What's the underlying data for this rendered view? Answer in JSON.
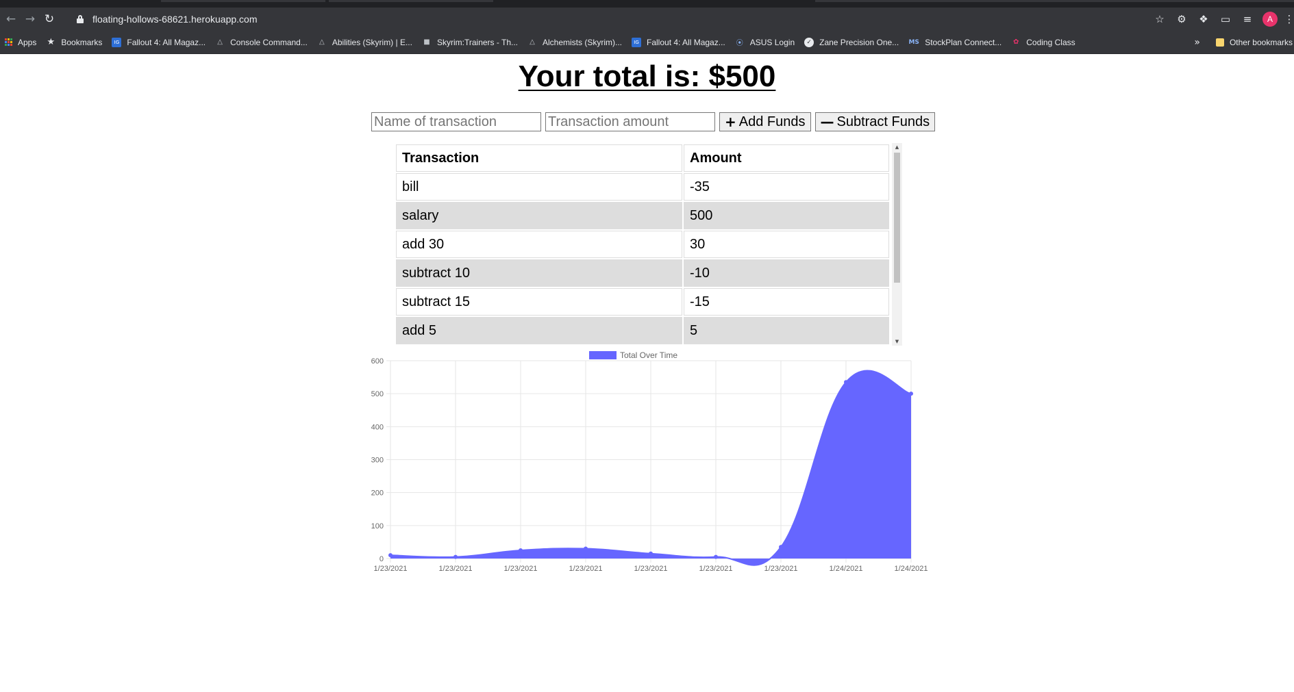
{
  "browser": {
    "url": "floating-hollows-68621.herokuapp.com",
    "avatar_letter": "A",
    "bookmarks": [
      {
        "label": "Apps",
        "icon": "apps-grid-icon"
      },
      {
        "label": "Bookmarks",
        "icon": "star-icon"
      },
      {
        "label": "Fallout 4: All Magaz...",
        "icon": "site-favicon"
      },
      {
        "label": "Console Command...",
        "icon": "site-favicon"
      },
      {
        "label": "Abilities (Skyrim) | E...",
        "icon": "site-favicon"
      },
      {
        "label": "Skyrim:Trainers - Th...",
        "icon": "site-favicon"
      },
      {
        "label": "Alchemists (Skyrim)...",
        "icon": "site-favicon"
      },
      {
        "label": "Fallout 4: All Magaz...",
        "icon": "site-favicon"
      },
      {
        "label": "ASUS Login",
        "icon": "broadcast-icon"
      },
      {
        "label": "Zane Precision One...",
        "icon": "globe-icon"
      },
      {
        "label": "StockPlan Connect...",
        "icon": "ms-icon"
      },
      {
        "label": "Coding Class",
        "icon": "site-favicon"
      }
    ],
    "other_bookmarks": "Other bookmarks"
  },
  "header": {
    "total_text": "Your total is: $500"
  },
  "form": {
    "name_placeholder": "Name of transaction",
    "amount_placeholder": "Transaction amount",
    "add_label": "Add Funds",
    "subtract_label": "Subtract Funds"
  },
  "table": {
    "headers": [
      "Transaction",
      "Amount"
    ],
    "rows": [
      [
        "bill",
        "-35"
      ],
      [
        "salary",
        "500"
      ],
      [
        "add 30",
        "30"
      ],
      [
        "subtract 10",
        "-10"
      ],
      [
        "subtract 15",
        "-15"
      ],
      [
        "add 5",
        "5"
      ]
    ]
  },
  "chart_data": {
    "type": "area",
    "title": "",
    "legend": [
      "Total Over Time"
    ],
    "legend_position": "top",
    "xlabel": "",
    "ylabel": "",
    "x": [
      "1/23/2021",
      "1/23/2021",
      "1/23/2021",
      "1/23/2021",
      "1/23/2021",
      "1/23/2021",
      "1/23/2021",
      "1/24/2021",
      "1/24/2021"
    ],
    "series": [
      {
        "name": "Total Over Time",
        "values": [
          10,
          5,
          25,
          30,
          15,
          5,
          35,
          535,
          500
        ]
      }
    ],
    "ylim": [
      0,
      600
    ],
    "yticks": [
      0,
      100,
      200,
      300,
      400,
      500,
      600
    ],
    "grid": true,
    "color": "#6666ff"
  }
}
